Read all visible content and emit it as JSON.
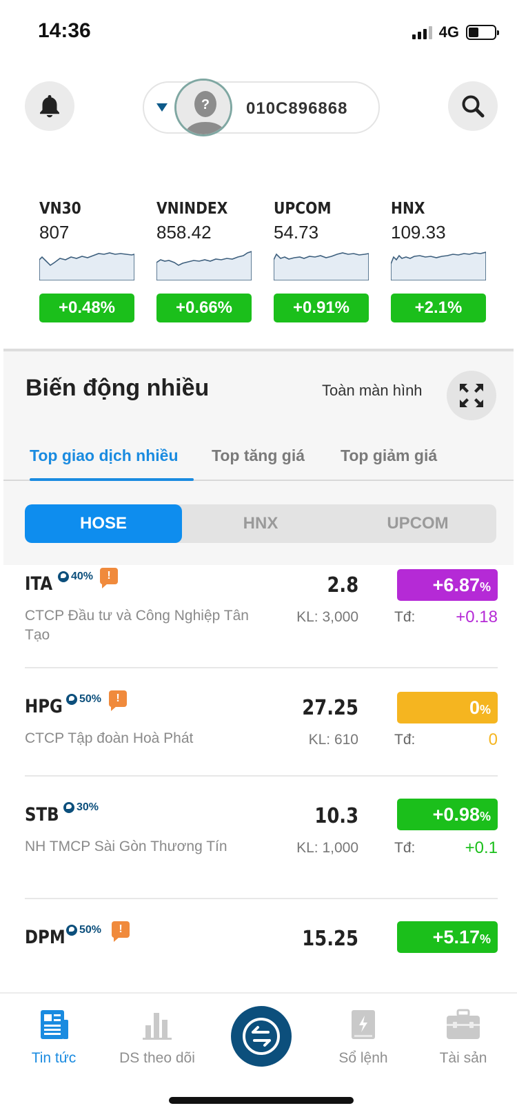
{
  "status_bar": {
    "time": "14:36",
    "network": "4G",
    "battery_level": 0.4
  },
  "header": {
    "account_id": "010C896868"
  },
  "indices": [
    {
      "name": "VN30",
      "value": "807",
      "change": "+0.48%",
      "color": "#1bbf1b"
    },
    {
      "name": "VNINDEX",
      "value": "858.42",
      "change": "+0.66%",
      "color": "#1bbf1b"
    },
    {
      "name": "UPCOM",
      "value": "54.73",
      "change": "+0.91%",
      "color": "#1bbf1b"
    },
    {
      "name": "HNX",
      "value": "109.33",
      "change": "+2.1%",
      "color": "#1bbf1b"
    }
  ],
  "section": {
    "title": "Biến động nhiều",
    "fullscreen_label": "Toàn màn hình",
    "tabs": [
      "Top giao dịch nhiều",
      "Top tăng giá",
      "Top giảm giá"
    ],
    "active_tab": 0,
    "exchanges": [
      "HOSE",
      "HNX",
      "UPCOM"
    ],
    "active_exchange": 0
  },
  "stocks": [
    {
      "symbol": "ITA",
      "margin": "40%",
      "warning": true,
      "warning_symbol": "!",
      "company": "CTCP Đầu tư và Công Nghiệp Tân Tạo",
      "price": "2.8",
      "volume": "KL: 3,000",
      "change": "+6.87",
      "pct": "%",
      "td_label": "Tđ:",
      "td_value": "+0.18",
      "color": "#b52ad6"
    },
    {
      "symbol": "HPG",
      "margin": "50%",
      "warning": true,
      "warning_symbol": "!",
      "company": "CTCP Tập đoàn Hoà Phát",
      "price": "27.25",
      "volume": "KL: 610",
      "change": "0",
      "pct": "%",
      "td_label": "Tđ:",
      "td_value": "0",
      "color": "#f5b520"
    },
    {
      "symbol": "STB",
      "margin": "30%",
      "warning": false,
      "company": "NH TMCP Sài Gòn Thương Tín",
      "price": "10.3",
      "volume": "KL: 1,000",
      "change": "+0.98",
      "pct": "%",
      "td_label": "Tđ:",
      "td_value": "+0.1",
      "color": "#1bbf1b"
    },
    {
      "symbol": "DPM",
      "margin": "50%",
      "warning": true,
      "warning_symbol": "!",
      "company": "",
      "price": "15.25",
      "volume": "",
      "change": "+5.17",
      "pct": "%",
      "td_label": "",
      "td_value": "",
      "color": "#1bbf1b"
    }
  ],
  "bottom_nav": {
    "items": [
      {
        "label": "Tin tức",
        "icon": "news-icon",
        "active": true
      },
      {
        "label": "DS theo dõi",
        "icon": "watchlist-chart-icon",
        "active": false
      },
      {
        "label": "Sổ lệnh",
        "icon": "order-book-icon",
        "active": false
      },
      {
        "label": "Tài sản",
        "icon": "briefcase-icon",
        "active": false
      }
    ],
    "center_icon": "trade-exchange-icon"
  },
  "colors": {
    "accent": "#1a8be0",
    "brand_dark": "#0c4f7c",
    "up": "#1bbf1b",
    "ceiling": "#b52ad6",
    "reference": "#f5b520"
  }
}
